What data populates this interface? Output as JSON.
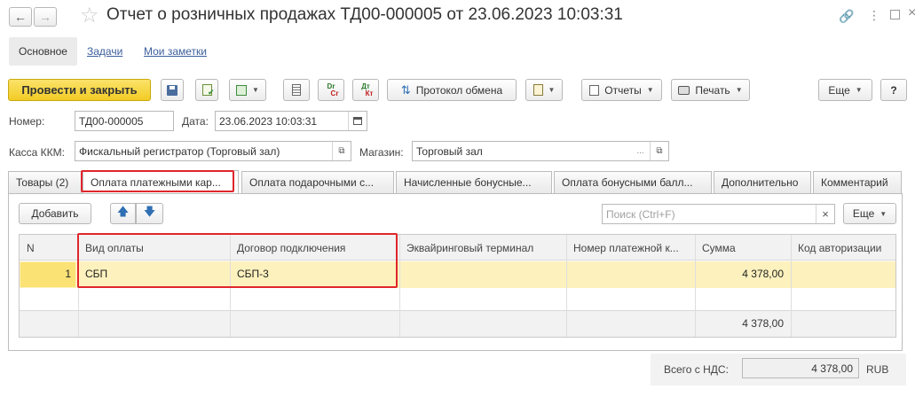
{
  "title": "Отчет о розничных продажах ТД00-000005 от 23.06.2023 10:03:31",
  "nav_tabs": [
    "Основное",
    "Задачи",
    "Мои заметки"
  ],
  "toolbar": {
    "post_close": "Провести и закрыть",
    "exchange_log": "Протокол обмена",
    "reports": "Отчеты",
    "print": "Печать",
    "more": "Еще",
    "help": "?",
    "dt_top": "Dr",
    "dt_bottom": "Cr",
    "dk_top": "Дт",
    "dk_bottom": "Кт"
  },
  "form": {
    "number_label": "Номер:",
    "number_value": "ТД00-000005",
    "date_label": "Дата:",
    "date_value": "23.06.2023 10:03:31",
    "kkm_label": "Касса ККМ:",
    "kkm_value": "Фискальный регистратор (Торговый зал)",
    "store_label": "Магазин:",
    "store_value": "Торговый зал",
    "store_dots": "..."
  },
  "tabs": [
    "Товары (2)",
    "Оплата платежными кар...",
    "Оплата подарочными с...",
    "Начисленные бонусные...",
    "Оплата бонусными балл...",
    "Дополнительно",
    "Комментарий"
  ],
  "table_toolbar": {
    "add": "Добавить",
    "search_placeholder": "Поиск (Ctrl+F)",
    "clear": "×",
    "more": "Еще"
  },
  "table": {
    "columns": [
      "N",
      "Вид оплаты",
      "Договор подключения",
      "Эквайринговый терминал",
      "Номер платежной к...",
      "Сумма",
      "Код авторизации"
    ],
    "rows": [
      {
        "n": "1",
        "payment_type": "СБП",
        "contract": "СБП-3",
        "terminal": "",
        "card_number": "",
        "amount": "4 378,00",
        "auth_code": ""
      }
    ],
    "footer_total": "4 378,00"
  },
  "summary": {
    "label": "Всего с НДС:",
    "value": "4 378,00",
    "currency": "RUB"
  },
  "colors": {
    "accent_yellow": "#f7d53a",
    "highlight_red": "#e0262c",
    "row_selected": "#fdf1bd"
  }
}
